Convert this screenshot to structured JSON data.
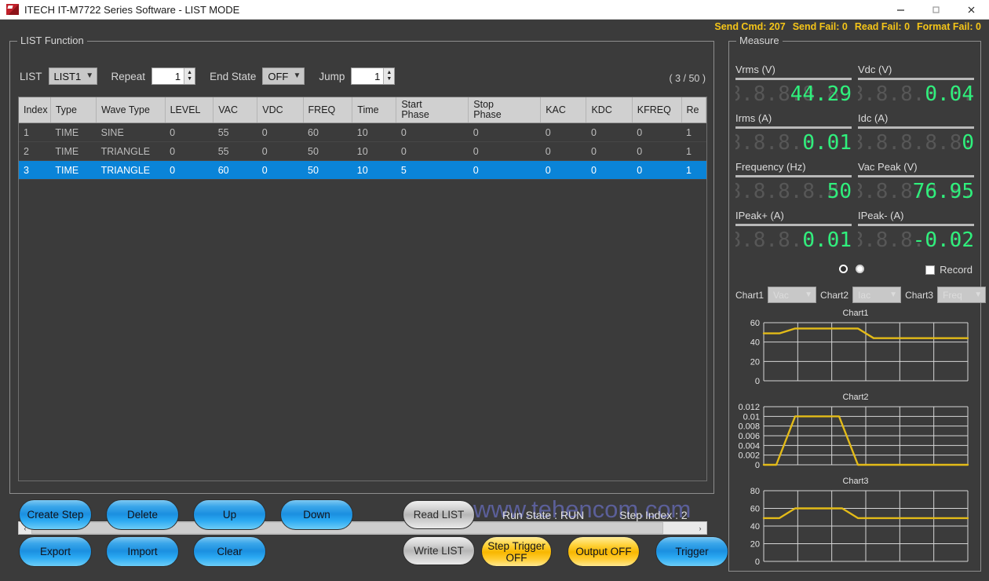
{
  "window": {
    "title": "ITECH IT-M7722 Series Software - LIST MODE",
    "minimize": "─",
    "maximize": "❐",
    "close": "✕"
  },
  "status": {
    "send_cmd": "Send Cmd: 207",
    "send_fail": "Send Fail: 0",
    "read_fail": "Read Fail: 0",
    "format_fail": "Format Fail: 0",
    "color": "#f5c518"
  },
  "list_function": {
    "group_title": "LIST Function",
    "list_label": "LIST",
    "list_value": "LIST1",
    "repeat_label": "Repeat",
    "repeat_value": "1",
    "end_state_label": "End State",
    "end_state_value": "OFF",
    "jump_label": "Jump",
    "jump_value": "1",
    "step_counter": "( 3 / 50 )",
    "columns": [
      "Index",
      "Type",
      "Wave Type",
      "LEVEL",
      "VAC",
      "VDC",
      "FREQ",
      "Time",
      "Start\nPhase",
      "Stop\nPhase",
      "KAC",
      "KDC",
      "KFREQ",
      "Re"
    ],
    "rows": [
      {
        "selected": false,
        "cells": [
          "1",
          "TIME",
          "SINE",
          "0",
          "55",
          "0",
          "60",
          "10",
          "0",
          "0",
          "0",
          "0",
          "0",
          "1"
        ]
      },
      {
        "selected": false,
        "cells": [
          "2",
          "TIME",
          "TRIANGLE",
          "0",
          "55",
          "0",
          "50",
          "10",
          "0",
          "0",
          "0",
          "0",
          "0",
          "1"
        ]
      },
      {
        "selected": true,
        "cells": [
          "3",
          "TIME",
          "TRIANGLE",
          "0",
          "60",
          "0",
          "50",
          "10",
          "5",
          "0",
          "0",
          "0",
          "0",
          "1"
        ]
      }
    ],
    "watermark": "www.tehencom.com",
    "scroll_left_icon": "‹",
    "scroll_right_icon": "›"
  },
  "buttons": {
    "create_step": "Create\nStep",
    "delete": "Delete",
    "up": "Up",
    "down": "Down",
    "export": "Export",
    "import": "Import",
    "clear": "Clear",
    "read_list": "Read LIST",
    "write_list": "Write LIST",
    "step_trigger": "Step Trigger\nOFF",
    "output": "Output\nOFF",
    "trigger": "Trigger"
  },
  "run_info": {
    "run_state": "Run State : RUN",
    "step_index": "Step Index : 2"
  },
  "measure": {
    "group_title": "Measure",
    "cells": [
      {
        "label": "Vrms (V)",
        "ghost": "8.8.8.8.8.8.",
        "value": "44.29"
      },
      {
        "label": "Vdc (V)",
        "ghost": "8.8.8.8.8.8.",
        "value": "0.04"
      },
      {
        "label": "Irms (A)",
        "ghost": "8.8.8.8.8.8.",
        "value": "0.01"
      },
      {
        "label": "Idc (A)",
        "ghost": "8.8.8.8.8.8.",
        "value": "0"
      },
      {
        "label": "Frequency (Hz)",
        "ghost": "8.8.8.8.8.8.",
        "value": "50"
      },
      {
        "label": "Vac Peak (V)",
        "ghost": "8.8.8.8.8.8.",
        "value": "76.95"
      },
      {
        "label": "IPeak+ (A)",
        "ghost": "8.8.8.8.8.8.",
        "value": "0.01"
      },
      {
        "label": "IPeak- (A)",
        "ghost": "8.8.8.8.8.8.",
        "value": "-0.02"
      }
    ],
    "record_label": "Record",
    "chart1_label": "Chart1",
    "chart1_select": "Vac",
    "chart2_label": "Chart2",
    "chart2_select": "Iac",
    "chart3_label": "Chart3",
    "chart3_select": "Freq",
    "digit_color": "#2ff07c",
    "ghost_color": "#575757"
  },
  "chart_data": [
    {
      "type": "line",
      "title": "Chart1",
      "xlabel": "",
      "ylabel": "",
      "ylim": [
        0,
        60
      ],
      "yticks": [
        0,
        20,
        40,
        60
      ],
      "grid": true,
      "legend": "none",
      "series_color": "#e3bb18",
      "x": [
        0,
        0.5,
        1.0,
        1.5,
        2.0,
        3.0,
        3.5,
        4.0,
        6.5
      ],
      "values": [
        49,
        49,
        54,
        54,
        54,
        54,
        44,
        44,
        44
      ]
    },
    {
      "type": "line",
      "title": "Chart2",
      "xlabel": "",
      "ylabel": "",
      "ylim": [
        0,
        0.012
      ],
      "yticks": [
        0,
        0.002,
        0.004,
        0.006,
        0.008,
        0.01,
        0.012
      ],
      "grid": true,
      "legend": "none",
      "series_color": "#e3bb18",
      "x": [
        0,
        0.4,
        1.0,
        1.5,
        2.0,
        2.4,
        3.0,
        6.5
      ],
      "values": [
        0,
        0,
        0.01,
        0.01,
        0.01,
        0.01,
        0,
        0
      ]
    },
    {
      "type": "line",
      "title": "Chart3",
      "xlabel": "",
      "ylabel": "",
      "ylim": [
        0,
        80
      ],
      "yticks": [
        0,
        20,
        40,
        60,
        80
      ],
      "grid": true,
      "legend": "none",
      "series_color": "#e3bb18",
      "x": [
        0,
        0.5,
        1.0,
        1.5,
        2.0,
        2.5,
        3.0,
        6.5
      ],
      "values": [
        49,
        49,
        60,
        60,
        60,
        60,
        49,
        49
      ]
    }
  ]
}
